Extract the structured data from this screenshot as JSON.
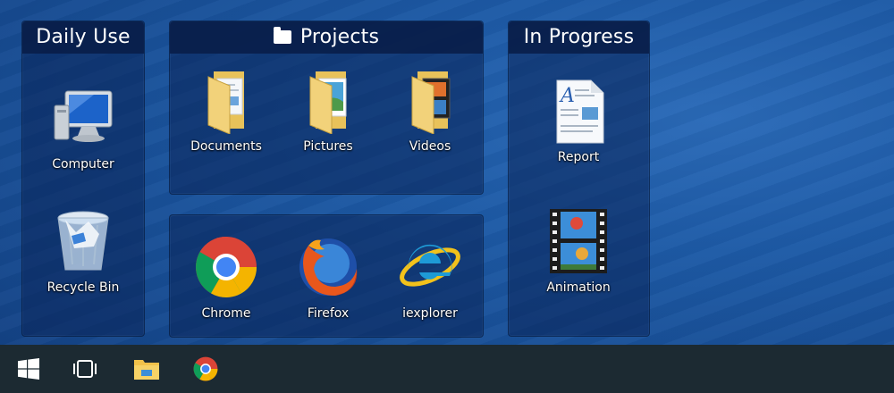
{
  "fences": {
    "daily_use": {
      "title": "Daily Use",
      "items": [
        {
          "label": "Computer",
          "icon": "computer-icon"
        },
        {
          "label": "Recycle Bin",
          "icon": "recycle-bin-icon"
        }
      ]
    },
    "projects": {
      "title": "Projects",
      "title_icon": "folder-icon",
      "items": [
        {
          "label": "Documents",
          "icon": "documents-folder-icon"
        },
        {
          "label": "Pictures",
          "icon": "pictures-folder-icon"
        },
        {
          "label": "Videos",
          "icon": "videos-folder-icon"
        }
      ]
    },
    "browsers": {
      "items": [
        {
          "label": "Chrome",
          "icon": "chrome-icon"
        },
        {
          "label": "Firefox",
          "icon": "firefox-icon"
        },
        {
          "label": "iexplorer",
          "icon": "internet-explorer-icon"
        }
      ]
    },
    "in_progress": {
      "title": "In Progress",
      "items": [
        {
          "label": "Report",
          "icon": "report-document-icon"
        },
        {
          "label": "Animation",
          "icon": "animation-film-icon"
        }
      ]
    }
  },
  "taskbar": {
    "items": [
      {
        "icon": "windows-start-icon"
      },
      {
        "icon": "task-view-icon"
      },
      {
        "icon": "file-explorer-icon"
      },
      {
        "icon": "chrome-icon"
      }
    ]
  },
  "colors": {
    "fence_background": "#0a2355",
    "fence_title_bar": "#081c46",
    "taskbar": "#1c2a32",
    "desktop": "#1d5aa6"
  }
}
